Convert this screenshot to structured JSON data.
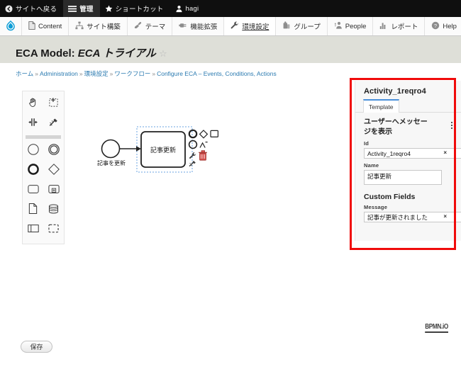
{
  "admin_bar": {
    "items": [
      {
        "label": "サイトへ戻る",
        "icon": "back-arrow-icon",
        "active": false
      },
      {
        "label": "管理",
        "icon": "hamburger-icon",
        "active": true
      },
      {
        "label": "ショートカット",
        "icon": "star-icon",
        "active": false
      },
      {
        "label": "hagi",
        "icon": "user-icon",
        "active": false
      }
    ]
  },
  "admin_menu": {
    "logo": "drupal-drop-icon",
    "items": [
      {
        "label": "Content",
        "icon": "document-icon",
        "current": false
      },
      {
        "label": "サイト構築",
        "icon": "sitemap-icon",
        "current": false
      },
      {
        "label": "テーマ",
        "icon": "brush-icon",
        "current": false
      },
      {
        "label": "機能拡張",
        "icon": "plug-icon",
        "current": false
      },
      {
        "label": "環境設定",
        "icon": "wrench-icon",
        "current": true
      },
      {
        "label": "グループ",
        "icon": "group-icon",
        "current": false
      },
      {
        "label": "People",
        "icon": "people-icon",
        "current": false
      },
      {
        "label": "レポート",
        "icon": "chart-icon",
        "current": false
      },
      {
        "label": "Help",
        "icon": "help-icon",
        "current": false
      }
    ],
    "collapse_label": "|←"
  },
  "page": {
    "title_prefix": "ECA Model:",
    "title_name": "ECA トライアル",
    "star_icon": "star-outline-icon"
  },
  "breadcrumb": {
    "items": [
      "ホーム",
      "Administration",
      "環境設定",
      "ワークフロー",
      "Configure ECA – Events, Conditions, Actions"
    ],
    "separator": "»"
  },
  "palette": {
    "tools": [
      {
        "name": "hand-tool",
        "icon": "hand-icon"
      },
      {
        "name": "lasso-tool",
        "icon": "lasso-icon"
      },
      {
        "name": "space-tool",
        "icon": "space-icon"
      },
      {
        "name": "global-connect-tool",
        "icon": "connect-wand-icon"
      }
    ],
    "shapes": [
      {
        "name": "create-start-event",
        "icon": "circle-thin-icon"
      },
      {
        "name": "create-intermediate-event",
        "icon": "double-circle-icon"
      },
      {
        "name": "create-end-event",
        "icon": "circle-thick-icon"
      },
      {
        "name": "create-gateway",
        "icon": "diamond-icon"
      },
      {
        "name": "create-task",
        "icon": "rounded-rect-icon"
      },
      {
        "name": "create-subprocess",
        "icon": "subprocess-icon"
      },
      {
        "name": "create-data-object",
        "icon": "data-object-icon"
      },
      {
        "name": "create-data-store",
        "icon": "data-store-icon"
      },
      {
        "name": "create-participant",
        "icon": "pool-icon"
      },
      {
        "name": "create-group",
        "icon": "dashed-rect-icon"
      }
    ]
  },
  "diagram": {
    "start_event_label": "記事を更新",
    "task_label": "記事更新",
    "context_pad": [
      {
        "name": "append-end-event",
        "icon": "circle-thick-icon"
      },
      {
        "name": "append-gateway",
        "icon": "diamond-icon"
      },
      {
        "name": "append-task",
        "icon": "rect-icon"
      },
      {
        "name": "append-intermediate-event",
        "icon": "circle-icon"
      },
      {
        "name": "connect",
        "icon": "connection-icon"
      },
      {
        "name": "change-type",
        "icon": "wrench-icon"
      },
      {
        "name": "delete",
        "icon": "trash-icon"
      },
      {
        "name": "global-connect",
        "icon": "connect-wand-icon"
      }
    ]
  },
  "properties": {
    "element_id_heading": "Activity_1reqro4",
    "tabs": [
      {
        "label": "Template",
        "selected": true
      }
    ],
    "template_name": "ユーザーへメッセージを表示",
    "menu_icon": "kebab-menu-icon",
    "fields": [
      {
        "label": "Id",
        "value": "Activity_1reqro4",
        "clear": "×",
        "type": "text"
      },
      {
        "label": "Name",
        "value": "記事更新",
        "type": "textarea"
      }
    ],
    "custom_fields_heading": "Custom Fields",
    "custom_fields": [
      {
        "label": "Message",
        "value": "記事が更新されました",
        "clear": "×",
        "type": "text"
      }
    ],
    "highlight_color": "#f00b0b"
  },
  "footer": {
    "logo_text": "BPMN.iO",
    "save_label": "保存"
  }
}
